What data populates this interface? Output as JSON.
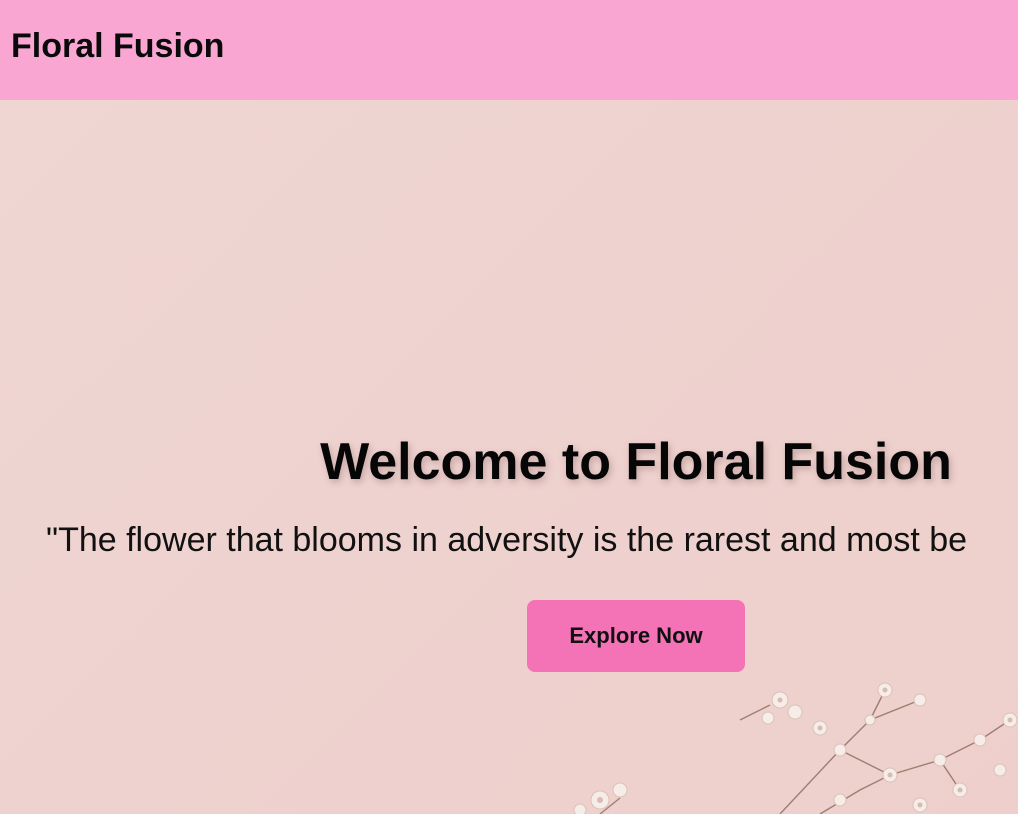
{
  "header": {
    "brand": "Floral Fusion",
    "background_color": "#f9a6d3"
  },
  "hero": {
    "title": "Welcome to Floral Fusion",
    "quote": "\"The flower that blooms in adversity is the rarest and most be",
    "cta_label": "Explore Now",
    "cta_color": "#f472b6",
    "background_color": "#efd4d0",
    "decoration_icon": "baby-breath-flowers-icon"
  }
}
